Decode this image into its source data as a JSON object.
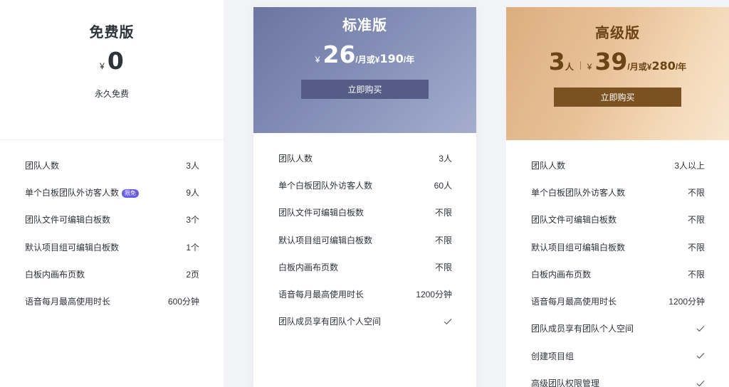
{
  "plans": [
    {
      "name": "免费版",
      "price": {
        "yen": "¥",
        "amount": "0"
      },
      "note": "永久免费",
      "features": [
        {
          "label": "团队人数",
          "value": "3人"
        },
        {
          "label": "单个白板团队外访客人数",
          "tag": "限免",
          "value": "9人"
        },
        {
          "label": "团队文件可编辑白板数",
          "value": "3个"
        },
        {
          "label": "默认项目组可编辑白板数",
          "value": "1个"
        },
        {
          "label": "白板内画布页数",
          "value": "2页"
        },
        {
          "label": "语音每月最高使用时长",
          "value": "600分钟"
        }
      ]
    },
    {
      "name": "标准版",
      "price": {
        "yen": "¥",
        "amount": "26",
        "per_month": "/月或",
        "yen2": "¥",
        "year_amount": "190",
        "per_year": "/年"
      },
      "button": "立即购买",
      "features": [
        {
          "label": "团队人数",
          "value": "3人"
        },
        {
          "label": "单个白板团队外访客人数",
          "value": "60人"
        },
        {
          "label": "团队文件可编辑白板数",
          "value": "不限"
        },
        {
          "label": "默认项目组可编辑白板数",
          "value": "不限"
        },
        {
          "label": "白板内画布页数",
          "value": "不限"
        },
        {
          "label": "语音每月最高使用时长",
          "value": "1200分钟"
        },
        {
          "label": "团队成员享有团队个人空间",
          "value_icon": "check-icon"
        }
      ]
    },
    {
      "name": "高级版",
      "price": {
        "people": "3",
        "people_unit": "人",
        "yen": "¥",
        "amount": "39",
        "per_month": "/月或",
        "yen2": "¥",
        "year_amount": "280",
        "per_year": "/年"
      },
      "button": "立即购买",
      "features": [
        {
          "label": "团队人数",
          "value": "3人以上"
        },
        {
          "label": "单个白板团队外访客人数",
          "value": "不限"
        },
        {
          "label": "团队文件可编辑白板数",
          "value": "不限"
        },
        {
          "label": "默认项目组可编辑白板数",
          "value": "不限"
        },
        {
          "label": "白板内画布页数",
          "value": "不限"
        },
        {
          "label": "语音每月最高使用时长",
          "value": "1200分钟"
        },
        {
          "label": "团队成员享有团队个人空间",
          "value_icon": "check-icon"
        },
        {
          "label": "创建项目组",
          "value_icon": "check-icon"
        },
        {
          "label": "高级团队权限管理",
          "value_icon": "check-icon"
        }
      ]
    }
  ],
  "colors": {
    "standard_header": "#7a84ad",
    "standard_button": "#555d86",
    "premium_header": "#e8c29a",
    "premium_button": "#7a5222",
    "free_tag": "#6b5ce7"
  }
}
